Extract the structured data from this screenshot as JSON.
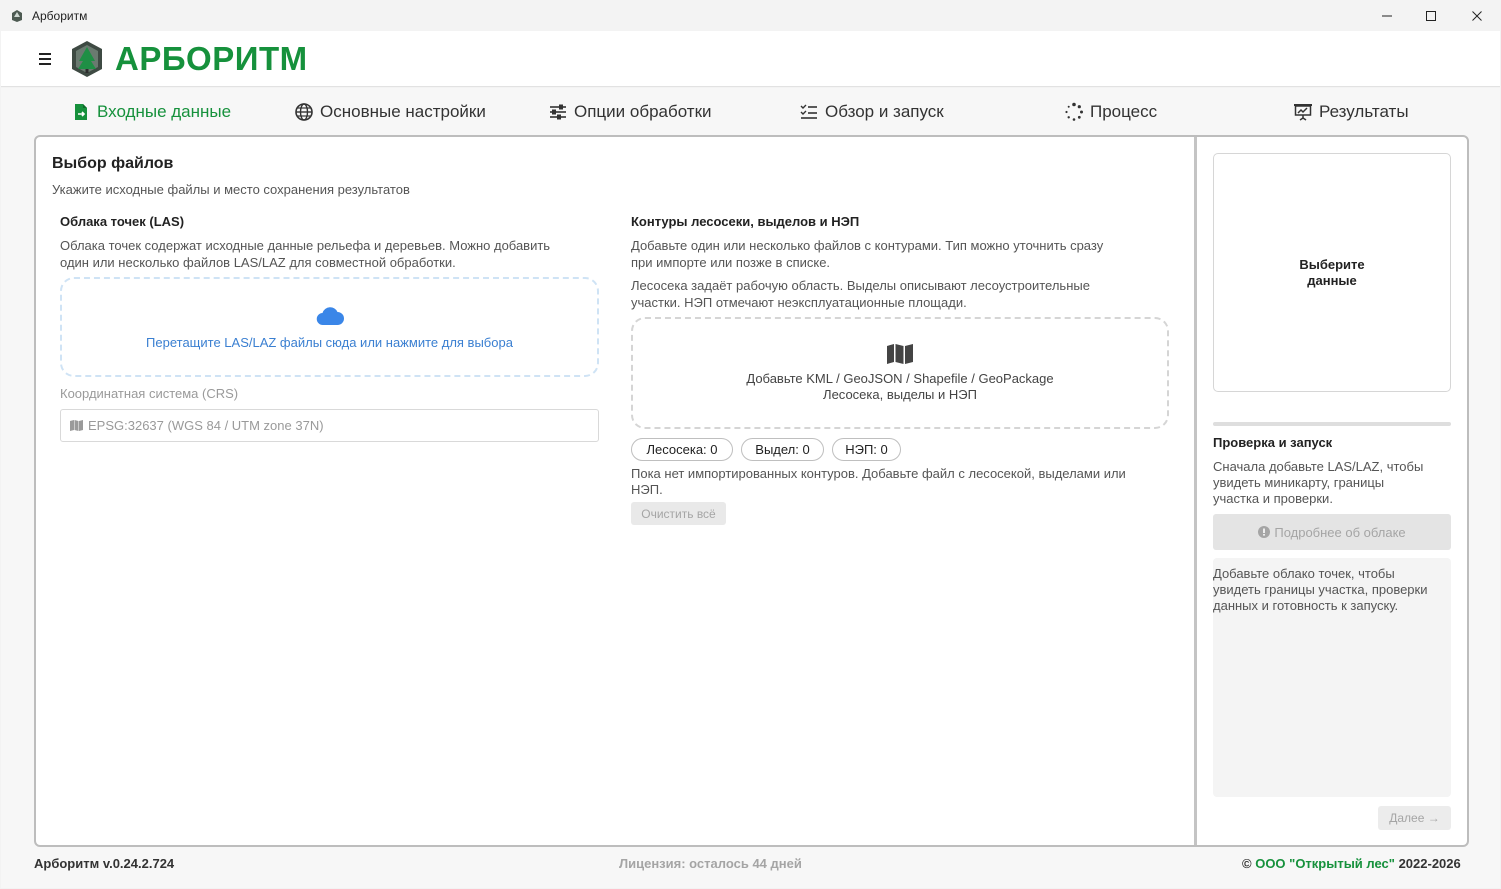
{
  "window": {
    "title": "Арборитм",
    "minimize_icon": "minimize-icon",
    "maximize_icon": "maximize-icon",
    "close_icon": "close-icon"
  },
  "header": {
    "brand": "АРБОРИТМ",
    "brand_color": "#16913c"
  },
  "tabs": [
    {
      "label": "Входные данные",
      "icon": "file-import-icon",
      "active": true
    },
    {
      "label": "Основные настройки",
      "icon": "globe-icon"
    },
    {
      "label": "Опции обработки",
      "icon": "sliders-icon"
    },
    {
      "label": "Обзор и запуск",
      "icon": "list-check-icon"
    },
    {
      "label": "Процесс",
      "icon": "spinner-icon"
    },
    {
      "label": "Результаты",
      "icon": "presentation-chart-icon"
    }
  ],
  "main": {
    "title": "Выбор файлов",
    "subtitle": "Укажите исходные файлы и место сохранения результатов",
    "las": {
      "heading": "Облака точек (LAS)",
      "desc_line1": "Облака точек содержат исходные данные рельефа и деревьев. Можно добавить",
      "desc_line2": "один или несколько файлов LAS/LAZ для совместной обработки.",
      "drop_text": "Перетащите LAS/LAZ файлы сюда или нажмите для выбора",
      "crs_label": "Координатная система (CRS)",
      "crs_value": "EPSG:32637 (WGS 84 / UTM zone 37N)"
    },
    "contours": {
      "heading": "Контуры лесосеки, выделов и НЭП",
      "desc1_line1": "Добавьте один или несколько файлов с контурами. Тип можно уточнить сразу",
      "desc1_line2": "при импорте или позже в списке.",
      "desc2_line1": "Лесосека задаёт рабочую область. Выделы описывают лесоустроительные",
      "desc2_line2": "участки. НЭП отмечают неэксплуатационные площади.",
      "drop_line1": "Добавьте KML / GeoJSON / Shapefile / GeoPackage",
      "drop_line2": "Лесосека, выделы и НЭП",
      "chips": [
        "Лесосека: 0",
        "Выдел: 0",
        "НЭП: 0"
      ],
      "empty_line1": "Пока нет импортированных контуров. Добавьте файл с лесосекой, выделами или",
      "empty_line2": "НЭП.",
      "clear_label": "Очистить всё"
    }
  },
  "sidebar": {
    "preview_line1": "Выберите",
    "preview_line2": "данные",
    "check_heading": "Проверка и запуск",
    "check_line1": "Сначала добавьте LAS/LAZ, чтобы",
    "check_line2": "увидеть миникарту, границы",
    "check_line3": "участка и проверки.",
    "details_label": "Подробнее об облаке",
    "info_line1": "Добавьте облако точек, чтобы",
    "info_line2": "увидеть границы участка, проверки",
    "info_line3": "данных и готовность к запуску.",
    "next_label": "Далее →"
  },
  "footer": {
    "version": "Арборитм v.0.24.2.724",
    "license": "Лицензия: осталось 44 дней",
    "copyright_prefix": "© ",
    "org": "ООО \"Открытый лес\"",
    "years": " 2022-2026"
  }
}
